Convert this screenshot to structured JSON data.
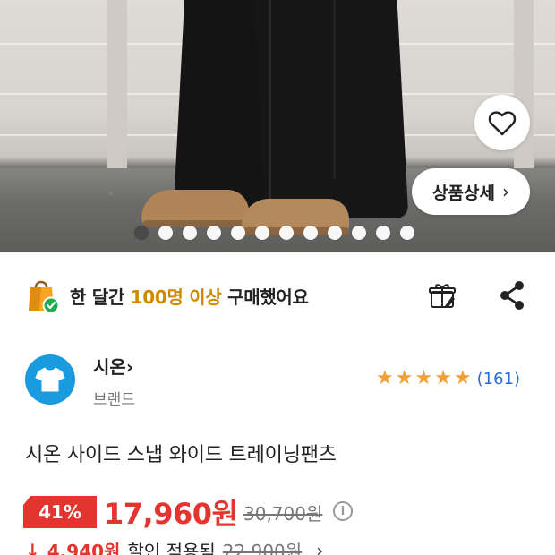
{
  "hero": {
    "detail_button_label": "상품상세",
    "detail_button_chevron": "›",
    "slide_count": 12,
    "active_slide": 1
  },
  "banner": {
    "prefix": "한 달간 ",
    "highlight": "100명 이상",
    "suffix": " 구매했어요",
    "highlight_color": "#d08a00"
  },
  "icons": {
    "wishlist": "heart-icon",
    "gift": "gift-icon",
    "share": "share-icon",
    "purchase_badge": "shopping-bag-check-icon",
    "brand_logo": "tshirt-icon",
    "info": "info-icon"
  },
  "brand": {
    "name": "시온",
    "name_chevron": "›",
    "type": "브랜드",
    "logo_color": "#1a9be0"
  },
  "rating": {
    "stars": 5,
    "count": "(161)",
    "star_color": "#f0a037"
  },
  "product": {
    "title": "시온 사이드 스냅 와이드 트레이닝팬츠"
  },
  "price": {
    "discount": "41%",
    "sale_price": "17,960원",
    "original_price": "30,700원",
    "info": "i",
    "accent_color": "#e3342f"
  },
  "coupon": {
    "arrow": "↓",
    "amount": "4,940원",
    "label": "할인 적용됨",
    "previous": "22,900원",
    "chevron": "›"
  }
}
